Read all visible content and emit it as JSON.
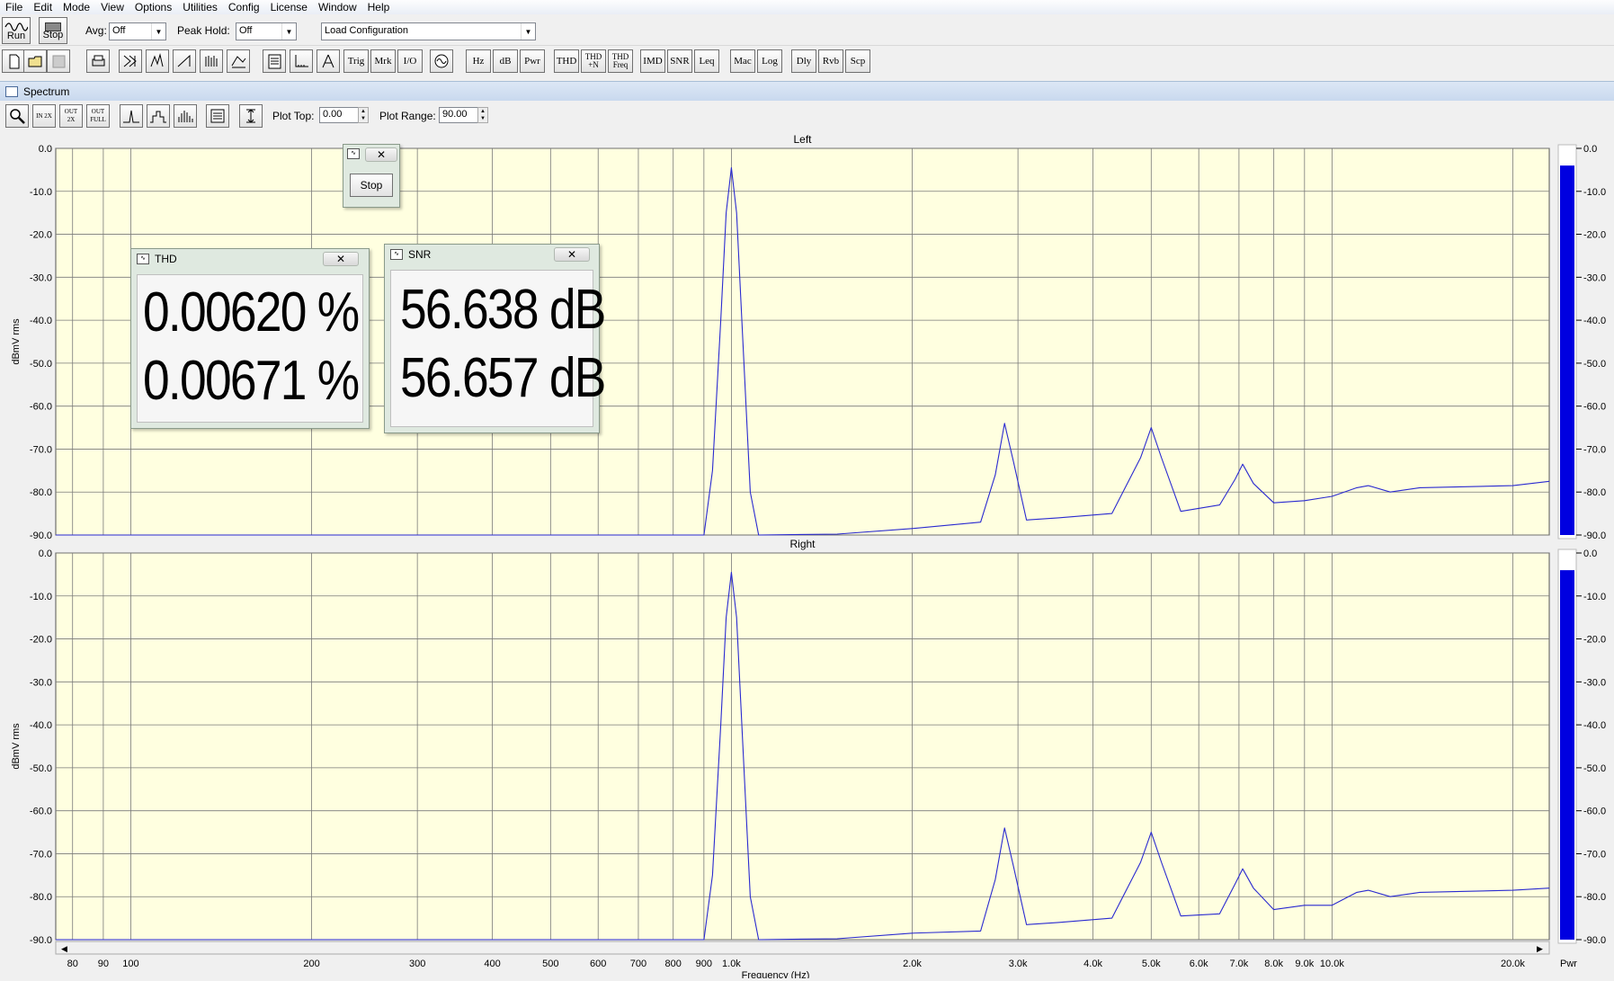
{
  "menu": [
    "File",
    "Edit",
    "Mode",
    "View",
    "Options",
    "Utilities",
    "Config",
    "License",
    "Window",
    "Help"
  ],
  "toolbar": {
    "run_label": "Run",
    "stop_label": "Stop",
    "avg_label": "Avg:",
    "avg_value": "Off",
    "peak_hold_label": "Peak Hold:",
    "peak_hold_value": "Off",
    "config_value": "Load Configuration"
  },
  "toolbar2": {
    "text_buttons": [
      "Trig",
      "Mrk",
      "I/O",
      "Hz",
      "dB",
      "Pwr",
      "THD",
      "THD\n+N",
      "THD\nFreq",
      "IMD",
      "SNR",
      "Leq",
      "Mac",
      "Log",
      "Dly",
      "Rvb",
      "Scp"
    ]
  },
  "spectrum": {
    "title": "Spectrum",
    "plot_top_label": "Plot Top:",
    "plot_top_value": "0.00",
    "plot_range_label": "Plot Range:",
    "plot_range_value": "90.00",
    "zoom_buttons": [
      "IN 2X",
      "OUT 2X",
      "OUT FULL"
    ]
  },
  "thd_window": {
    "title": "THD",
    "values": [
      "0.00620 %",
      "0.00671 %"
    ]
  },
  "snr_window": {
    "title": "SNR",
    "values": [
      "56.638 dB",
      "56.657 dB"
    ]
  },
  "stop_window": {
    "button_label": "Stop"
  },
  "chart_data": [
    {
      "type": "line",
      "title": "Left",
      "xlabel": "Frequency (Hz)",
      "ylabel": "dBmV rms",
      "x_scale": "log",
      "xlim": [
        75,
        23000
      ],
      "ylim": [
        -90,
        0
      ],
      "x_ticks": [
        80,
        90,
        100,
        200,
        300,
        400,
        500,
        600,
        700,
        800,
        900,
        1000,
        2000,
        3000,
        4000,
        5000,
        6000,
        7000,
        8000,
        9000,
        10000,
        20000
      ],
      "x_tick_labels": [
        "80",
        "90",
        "100",
        "200",
        "300",
        "400",
        "500",
        "600",
        "700",
        "800",
        "900",
        "1.0k",
        "2.0k",
        "3.0k",
        "4.0k",
        "5.0k",
        "6.0k",
        "7.0k",
        "8.0k",
        "9.0k",
        "10.0k",
        "20.0k"
      ],
      "y_ticks": [
        0,
        -10,
        -20,
        -30,
        -40,
        -50,
        -60,
        -70,
        -80,
        -90
      ],
      "y_tick_labels": [
        "0.0",
        "-10.0",
        "-20.0",
        "-30.0",
        "-40.0",
        "-50.0",
        "-60.0",
        "-70.0",
        "-80.0",
        "-90.0"
      ],
      "x": [
        75,
        500,
        900,
        930,
        960,
        980,
        1000,
        1020,
        1045,
        1075,
        1110,
        1500,
        2000,
        2600,
        2750,
        2850,
        2950,
        3100,
        3500,
        4300,
        4800,
        5000,
        5200,
        5600,
        6500,
        6900,
        7100,
        7400,
        8000,
        9000,
        10000,
        11000,
        11500,
        12500,
        14000,
        20000,
        23000
      ],
      "y": [
        -90,
        -90,
        -90,
        -75,
        -40,
        -15,
        -4.5,
        -15,
        -45,
        -80,
        -90,
        -89.8,
        -88.5,
        -87,
        -76,
        -64,
        -73,
        -86.5,
        -86,
        -85,
        -72,
        -65,
        -72,
        -84.5,
        -83,
        -77,
        -73.5,
        -78,
        -82.5,
        -82,
        -81,
        -79,
        -78.5,
        -80,
        -79,
        -78.5,
        -77.5
      ],
      "series": [
        {
          "name": "Left",
          "color": "#2a2ad0"
        }
      ],
      "level_meter": {
        "label": "Pwr",
        "level_db": -4
      }
    },
    {
      "type": "line",
      "title": "Right",
      "xlabel": "Frequency (Hz)",
      "ylabel": "dBmV rms",
      "x_scale": "log",
      "xlim": [
        75,
        23000
      ],
      "ylim": [
        -90,
        0
      ],
      "x_ticks": [
        80,
        90,
        100,
        200,
        300,
        400,
        500,
        600,
        700,
        800,
        900,
        1000,
        2000,
        3000,
        4000,
        5000,
        6000,
        7000,
        8000,
        9000,
        10000,
        20000
      ],
      "x_tick_labels": [
        "80",
        "90",
        "100",
        "200",
        "300",
        "400",
        "500",
        "600",
        "700",
        "800",
        "900",
        "1.0k",
        "2.0k",
        "3.0k",
        "4.0k",
        "5.0k",
        "6.0k",
        "7.0k",
        "8.0k",
        "9.0k",
        "10.0k",
        "20.0k"
      ],
      "y_ticks": [
        0,
        -10,
        -20,
        -30,
        -40,
        -50,
        -60,
        -70,
        -80,
        -90
      ],
      "y_tick_labels": [
        "0.0",
        "-10.0",
        "-20.0",
        "-30.0",
        "-40.0",
        "-50.0",
        "-60.0",
        "-70.0",
        "-80.0",
        "-90.0"
      ],
      "x": [
        75,
        500,
        900,
        930,
        960,
        980,
        1000,
        1020,
        1045,
        1075,
        1110,
        1500,
        2000,
        2600,
        2750,
        2850,
        2950,
        3100,
        3500,
        4300,
        4800,
        5000,
        5200,
        5600,
        6500,
        6900,
        7100,
        7400,
        8000,
        9000,
        10000,
        11000,
        11500,
        12500,
        14000,
        20000,
        23000
      ],
      "y": [
        -90,
        -90,
        -90,
        -75,
        -40,
        -15,
        -4.5,
        -15,
        -45,
        -80,
        -90,
        -89.8,
        -88.5,
        -88,
        -76,
        -64,
        -73,
        -86.5,
        -86,
        -85,
        -72,
        -65,
        -72,
        -84.5,
        -84,
        -77,
        -73.5,
        -78,
        -83,
        -82,
        -82,
        -79,
        -78.5,
        -80,
        -79,
        -78.5,
        -78
      ],
      "series": [
        {
          "name": "Right",
          "color": "#2a2ad0"
        }
      ],
      "level_meter": {
        "label": "Pwr",
        "level_db": -4
      }
    }
  ],
  "colors": {
    "plot_bg": "#ffffe0",
    "trace": "#2a2ad0",
    "grid": "#7a7a7a",
    "meter": "#0000e0"
  }
}
